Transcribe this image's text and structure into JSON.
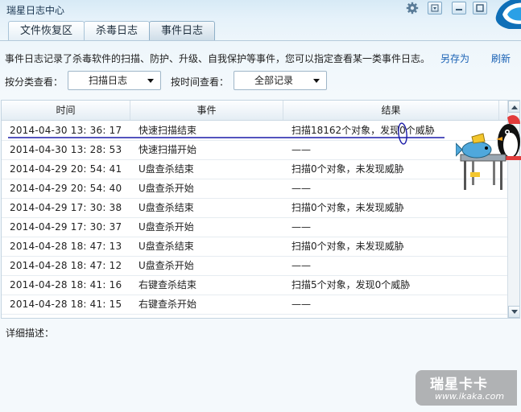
{
  "window": {
    "title": "瑞星日志中心"
  },
  "tabs": [
    {
      "label": "文件恢复区",
      "active": false
    },
    {
      "label": "杀毒日志",
      "active": false
    },
    {
      "label": "事件日志",
      "active": true
    }
  ],
  "description": "事件日志记录了杀毒软件的扫描、防护、升级、自我保护等事件，您可以指定查看某一类事件日志。",
  "actions": {
    "save_as": "另存为",
    "refresh": "刷新"
  },
  "filters": {
    "category_label": "按分类查看：",
    "category_value": "扫描日志",
    "time_label": "按时间查看：",
    "time_value": "全部记录"
  },
  "table": {
    "columns": [
      "时间",
      "事件",
      "结果"
    ],
    "rows": [
      {
        "time": "2014-04-30 13: 36: 17",
        "event": "快速扫描结束",
        "result": "扫描18162个对象，发现0个威胁"
      },
      {
        "time": "2014-04-30 13: 28: 53",
        "event": "快速扫描开始",
        "result": "——"
      },
      {
        "time": "2014-04-29 20: 54: 41",
        "event": "U盘查杀结束",
        "result": "扫描0个对象，未发现威胁"
      },
      {
        "time": "2014-04-29 20: 54: 40",
        "event": "U盘查杀开始",
        "result": "——"
      },
      {
        "time": "2014-04-29 17: 30: 38",
        "event": "U盘查杀结束",
        "result": "扫描0个对象，未发现威胁"
      },
      {
        "time": "2014-04-29 17: 30: 37",
        "event": "U盘查杀开始",
        "result": "——"
      },
      {
        "time": "2014-04-28 18: 47: 13",
        "event": "U盘查杀结束",
        "result": "扫描0个对象，未发现威胁"
      },
      {
        "time": "2014-04-28 18: 47: 12",
        "event": "U盘查杀开始",
        "result": "——"
      },
      {
        "time": "2014-04-28 18: 41: 16",
        "event": "右键查杀结束",
        "result": "扫描5个对象，发现0个威胁"
      },
      {
        "time": "2014-04-28 18: 41: 15",
        "event": "右键查杀开始",
        "result": "——"
      }
    ]
  },
  "details": {
    "label": "详细描述："
  },
  "watermark": {
    "brand": "瑞星卡卡",
    "url": "www.ikaka.com"
  },
  "icons": {
    "settings": "gear-icon",
    "menu": "dropdown-menu-icon",
    "minimize": "minimize-icon",
    "maximize": "maximize-icon",
    "scroll_up": "scroll-up-arrow-icon",
    "scroll_down": "scroll-down-arrow-icon"
  },
  "colors": {
    "link": "#1a62b5",
    "annotation": "#1a1aa8",
    "window_bg": "#eef6fb"
  }
}
